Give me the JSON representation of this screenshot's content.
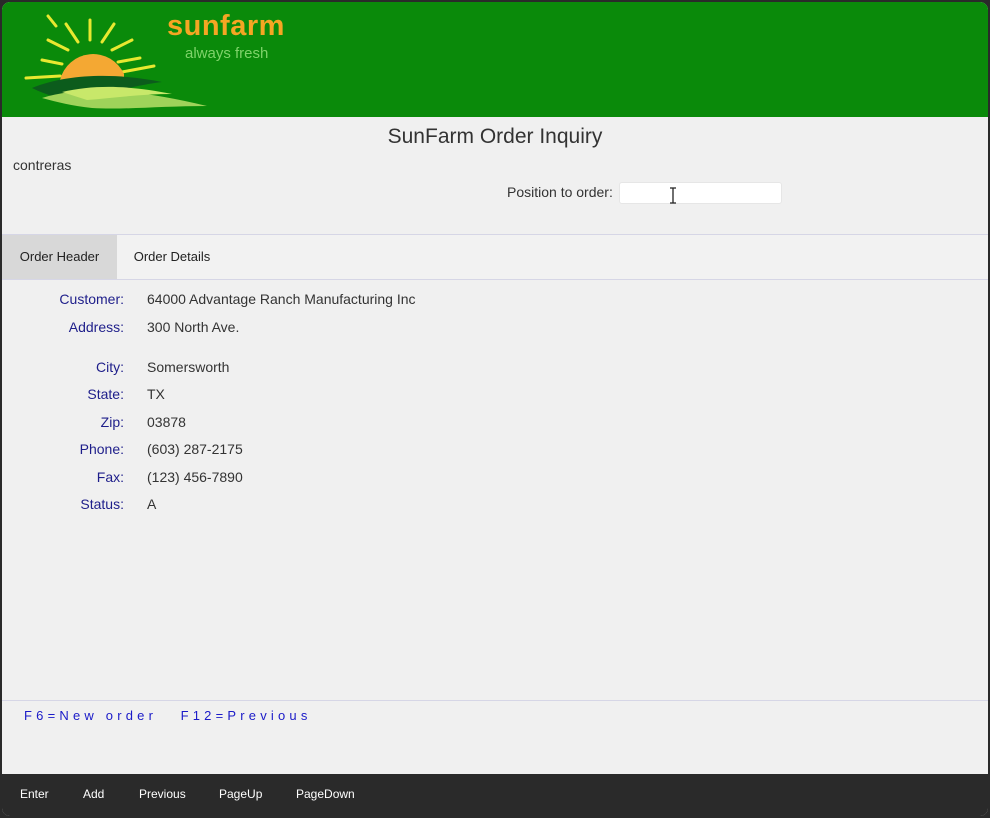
{
  "header": {
    "brand": "sunfarm",
    "tagline": "always fresh",
    "colors": {
      "banner": "#0a8a0a",
      "brand": "#f5a623",
      "tagline": "#7fd36a"
    },
    "logo_icon": "sunrise-icon"
  },
  "page": {
    "title": "SunFarm Order Inquiry",
    "user": "contreras",
    "position_label": "Position to order:",
    "position_value": ""
  },
  "tabs": [
    {
      "label": "Order Header",
      "active": true
    },
    {
      "label": "Order Details",
      "active": false
    }
  ],
  "fields": [
    {
      "label": "Customer:",
      "value": "64000 Advantage Ranch Manufacturing Inc"
    },
    {
      "label": "Address:",
      "value": "300 North Ave."
    },
    {
      "label": "City:",
      "value": "Somersworth"
    },
    {
      "label": "State:",
      "value": "TX"
    },
    {
      "label": "Zip:",
      "value": "03878"
    },
    {
      "label": "Phone:",
      "value": "(603) 287-2175"
    },
    {
      "label": "Fax:",
      "value": "(123) 456-7890"
    },
    {
      "label": "Status:",
      "value": "A"
    }
  ],
  "function_keys": [
    {
      "label": "F6=New order"
    },
    {
      "label": "F12=Previous"
    }
  ],
  "bottom_buttons": [
    "Enter",
    "Add",
    "Previous",
    "PageUp",
    "PageDown"
  ]
}
